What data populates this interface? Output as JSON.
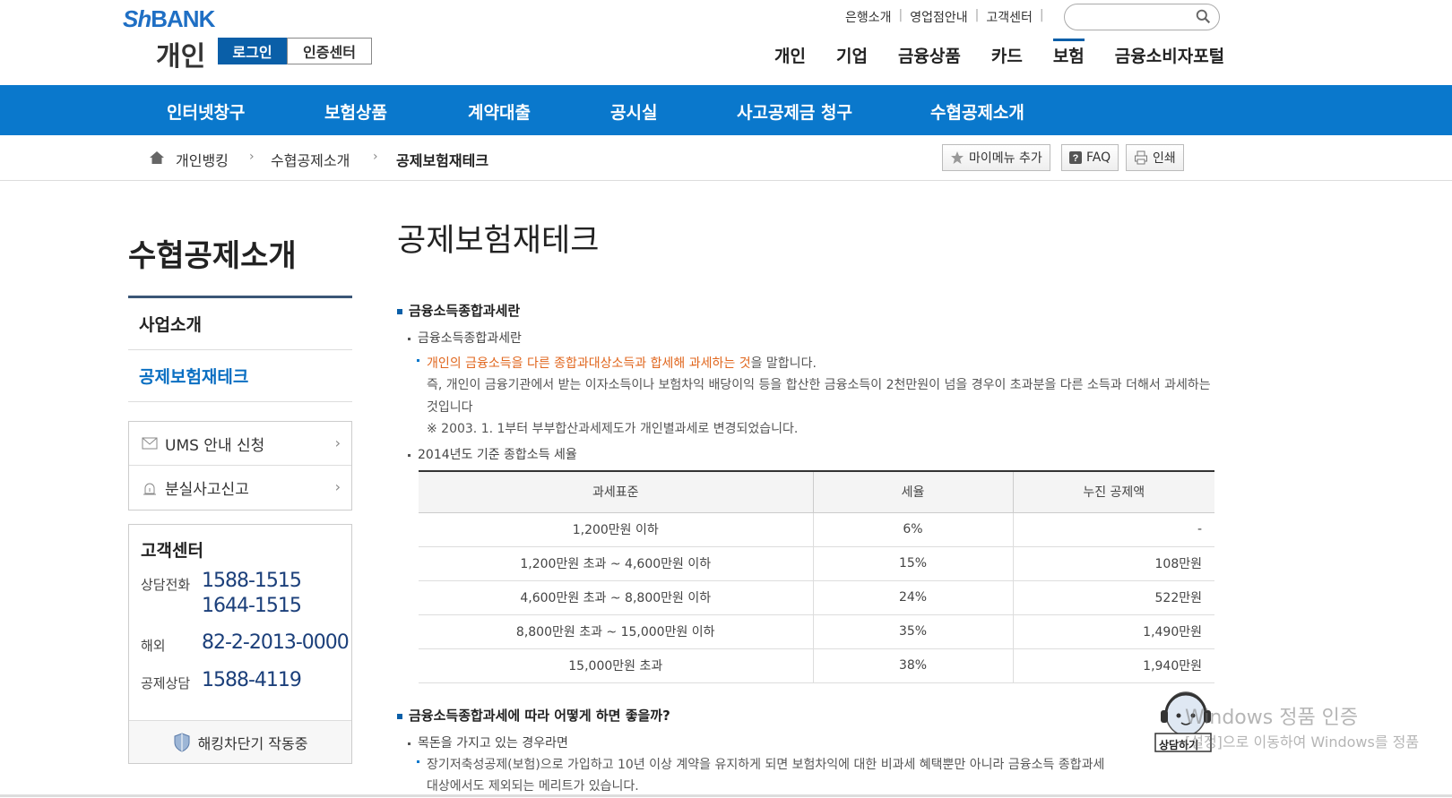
{
  "header": {
    "logo_en": "Sh",
    "logo_bank": "BANK",
    "logo_ko": "개인",
    "login_label": "로그인",
    "cert_label": "인증센터",
    "util_links": [
      "은행소개",
      "영업점안내",
      "고객센터"
    ],
    "search_placeholder": "",
    "gnb": [
      "개인",
      "기업",
      "금융상품",
      "카드",
      "보험",
      "금융소비자포털"
    ],
    "gnb_active": "보험"
  },
  "navbar": {
    "items": [
      "인터넷창구",
      "보험상품",
      "계약대출",
      "공시실",
      "사고공제금 청구",
      "수협공제소개"
    ]
  },
  "breadcrumb": {
    "items": [
      "개인뱅킹",
      "수협공제소개",
      "공제보험재테크"
    ],
    "tools": [
      "마이메뉴 추가",
      "FAQ",
      "인쇄"
    ]
  },
  "sidebar": {
    "title": "수협공제소개",
    "menu": [
      "사업소개",
      "공제보험재테크"
    ],
    "active": "공제보험재테크",
    "links": [
      "UMS 안내 신청",
      "분실사고신고"
    ],
    "cs": {
      "title": "고객센터",
      "phone_label": "상담전화",
      "phone1": "1588-1515",
      "phone2": "1644-1515",
      "overseas_label": "해외",
      "overseas": "82-2-2013-0000",
      "deduct_label": "공제상담",
      "deduct": "1588-4119",
      "hacking": "해킹차단기 작동중"
    }
  },
  "main": {
    "title": "공제보험재테크",
    "h3_1": "금융소득종합과세란",
    "h4_1": "금융소득종합과세란",
    "p1_orange": "개인의 금융소득을 다른 종합과대상소득과 합세해 과세하는 것",
    "p1_rest": "을 말합니다.",
    "p2": "즉, 개인이 금융기관에서 받는 이자소득이나 보험차익 배당이익 등을 합산한 금융소득이 2천만원이 넘을 경우이 초과분을 다른 소득과 더해서 과세하는 것입니다",
    "p3": "※ 2003. 1. 1부터 부부합산과세제도가 개인별과세로 변경되었습니다.",
    "h4_2": "2014년도 기준 종합소득 세율",
    "table": {
      "headers": [
        "과세표준",
        "세율",
        "누진 공제액"
      ],
      "rows": [
        [
          "1,200만원 이하",
          "6%",
          "-"
        ],
        [
          "1,200만원 초과 ~ 4,600만원 이하",
          "15%",
          "108만원"
        ],
        [
          "4,600만원 초과 ~ 8,800만원 이하",
          "24%",
          "522만원"
        ],
        [
          "8,800만원 초과 ~ 15,000만원 이하",
          "35%",
          "1,490만원"
        ],
        [
          "15,000만원 초과",
          "38%",
          "1,940만원"
        ]
      ]
    },
    "h3_2": "금융소득종합과세에 따라 어떻게 하면 좋을까?",
    "h4_3": "목돈을 가지고 있는 경우라면",
    "p4": "장기저축성공제(보험)으로 가입하고 10년 이상 계약을 유지하게 되면 보험차익에 대한 비과세 혜택뿐만 아니라 금융소득 종합과세",
    "p5": "대상에서도 제외되는 메리트가 있습니다."
  },
  "overlay": {
    "chatbot": "상담하기",
    "watermark_title": "Windows 정품 인증",
    "watermark_sub": "[설정]으로 이동하여 Windows를 정품"
  }
}
